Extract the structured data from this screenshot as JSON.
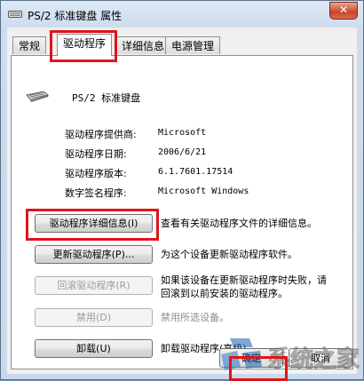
{
  "window": {
    "title": "PS/2 标准键盘 属性",
    "close_symbol": "✕"
  },
  "tabs": [
    {
      "label": "常规"
    },
    {
      "label": "驱动程序"
    },
    {
      "label": "详细信息"
    },
    {
      "label": "电源管理"
    }
  ],
  "device": {
    "name": "PS/2 标准键盘"
  },
  "info": [
    {
      "label": "驱动程序提供商:",
      "value": "Microsoft"
    },
    {
      "label": "驱动程序日期:",
      "value": "2006/6/21"
    },
    {
      "label": "驱动程序版本:",
      "value": "6.1.7601.17514"
    },
    {
      "label": "数字签名程序:",
      "value": "Microsoft Windows"
    }
  ],
  "actions": [
    {
      "button": "驱动程序详细信息(I)",
      "desc": "查看有关驱动程序文件的详细信息。",
      "enabled": true
    },
    {
      "button": "更新驱动程序(P)...",
      "desc": "为这个设备更新驱动程序软件。",
      "enabled": true
    },
    {
      "button": "回滚驱动程序(R)",
      "desc1": "如果该设备在更新驱动程序时失败，请",
      "desc2": "回滚到以前安装的驱动程序。",
      "enabled": false
    },
    {
      "button": "禁用(D)",
      "desc": "禁用所选设备。",
      "enabled": false
    },
    {
      "button": "卸载(U)",
      "desc": "卸载驱动程序(高级)。",
      "enabled": true
    }
  ],
  "footer": {
    "ok": "确定",
    "cancel": "取消"
  },
  "watermark": {
    "text": "系统之家"
  },
  "colors": {
    "highlight": "#e0141b",
    "title_bg": "#cddcee",
    "close_red": "#c8462c"
  }
}
